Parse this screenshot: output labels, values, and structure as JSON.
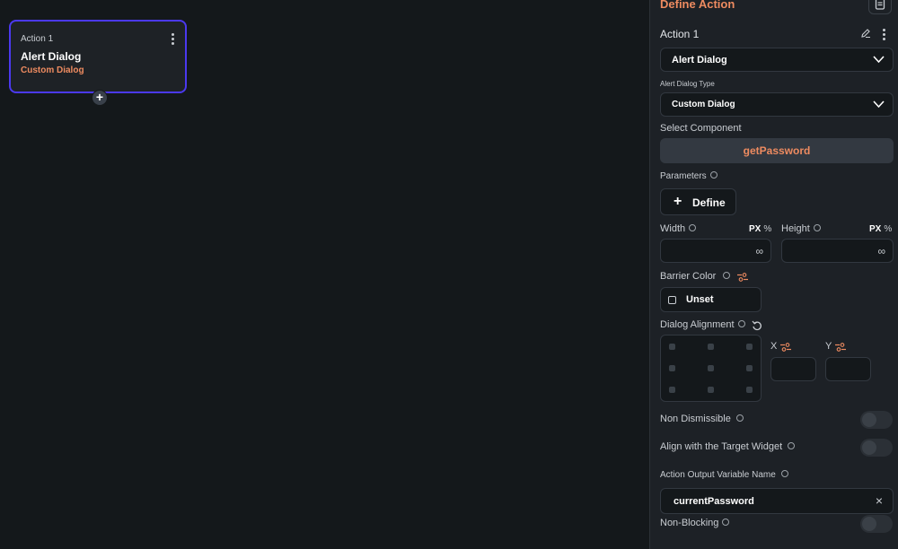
{
  "canvas": {
    "node": {
      "label": "Action 1",
      "title": "Alert Dialog",
      "subtitle": "Custom Dialog",
      "accent": "#4b39ef",
      "add_label": "+"
    }
  },
  "panel": {
    "title": "Define Action",
    "doc_icon": "document-icon",
    "action_name": "Action 1",
    "action_type": "Alert Dialog",
    "dialog_type_label": "Alert Dialog Type",
    "dialog_type": "Custom Dialog",
    "select_component_label": "Select Component",
    "component": "getPassword",
    "parameters_label": "Parameters",
    "define_label": "Define",
    "width_label": "Width",
    "height_label": "Height",
    "unit_px": "PX",
    "unit_pct": "%",
    "infinity": "∞",
    "barrier_color_label": "Barrier Color",
    "barrier_color_value": "Unset",
    "dialog_alignment_label": "Dialog Alignment",
    "x_label": "X",
    "y_label": "Y",
    "non_dismissible_label": "Non Dismissible",
    "non_dismissible": false,
    "align_target_label": "Align with the Target Widget",
    "align_target": false,
    "output_var_label": "Action Output Variable Name",
    "output_var": "currentPassword",
    "clear_icon": "×",
    "non_blocking_label": "Non-Blocking",
    "non_blocking": false
  },
  "colors": {
    "background": "#14181b",
    "panel": "#1d2126",
    "accent_orange": "#ee8b60",
    "accent_blue": "#4b39ef"
  }
}
